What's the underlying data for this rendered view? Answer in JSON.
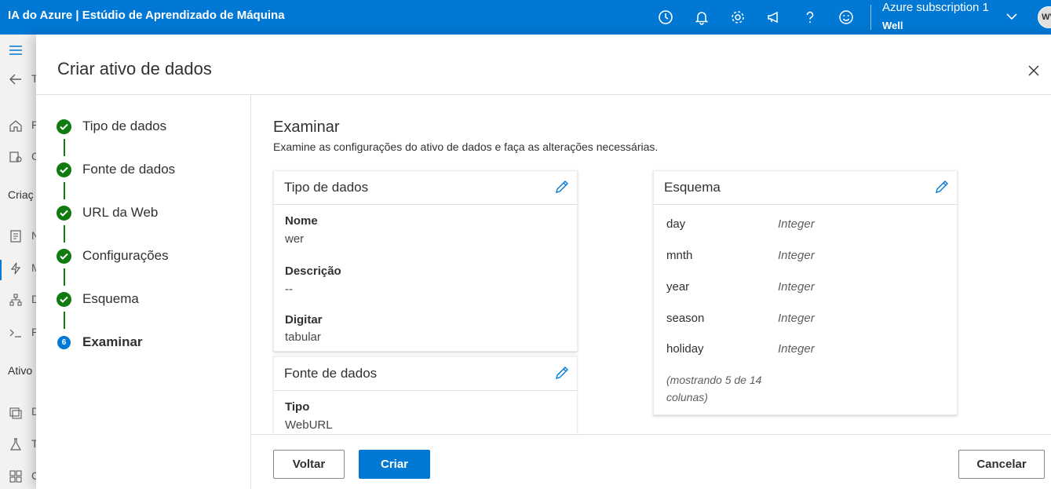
{
  "topbar": {
    "title": "IA do Azure | Estúdio de Aprendizado de Máquina",
    "subscription": "Azure subscription 1",
    "directory": "Well",
    "avatar_initials": "WV",
    "icons": [
      "clock-icon",
      "bell-icon",
      "gear-icon",
      "megaphone-icon",
      "help-icon",
      "smiley-icon",
      "chevron-down-icon"
    ]
  },
  "leftnav": {
    "back_letter": "T",
    "section_create": "Criaç",
    "section_assets": "Ativo",
    "item_letters": [
      "P",
      "C",
      "N",
      "M",
      "D",
      "P",
      "D",
      "T",
      "C"
    ]
  },
  "panel": {
    "title": "Criar ativo de dados",
    "close_label": "Fechar"
  },
  "steps": [
    {
      "label": "Tipo de dados",
      "state": "done"
    },
    {
      "label": "Fonte de dados",
      "state": "done"
    },
    {
      "label": "URL da Web",
      "state": "done"
    },
    {
      "label": "Configurações",
      "state": "done"
    },
    {
      "label": "Esquema",
      "state": "done"
    },
    {
      "label": "Examinar",
      "state": "current",
      "number": "6"
    }
  ],
  "review": {
    "title": "Examinar",
    "description": "Examine as configurações do ativo de dados e faça as alterações necessárias."
  },
  "card_data_type": {
    "title": "Tipo de dados",
    "fields": [
      {
        "label": "Nome",
        "value": "wer"
      },
      {
        "label": "Descrição",
        "value": "--"
      },
      {
        "label": "Digitar",
        "value": "tabular"
      }
    ]
  },
  "card_data_source": {
    "title": "Fonte de dados",
    "fields": [
      {
        "label": "Tipo",
        "value": "WebURL"
      }
    ]
  },
  "card_schema": {
    "title": "Esquema",
    "rows": [
      {
        "name": "day",
        "type": "Integer"
      },
      {
        "name": "mnth",
        "type": "Integer"
      },
      {
        "name": "year",
        "type": "Integer"
      },
      {
        "name": "season",
        "type": "Integer"
      },
      {
        "name": "holiday",
        "type": "Integer"
      }
    ],
    "note": "(mostrando 5 de 14 colunas)"
  },
  "footer": {
    "back": "Voltar",
    "create": "Criar",
    "cancel": "Cancelar"
  },
  "colors": {
    "brand": "#0078d4",
    "success": "#107c10"
  }
}
